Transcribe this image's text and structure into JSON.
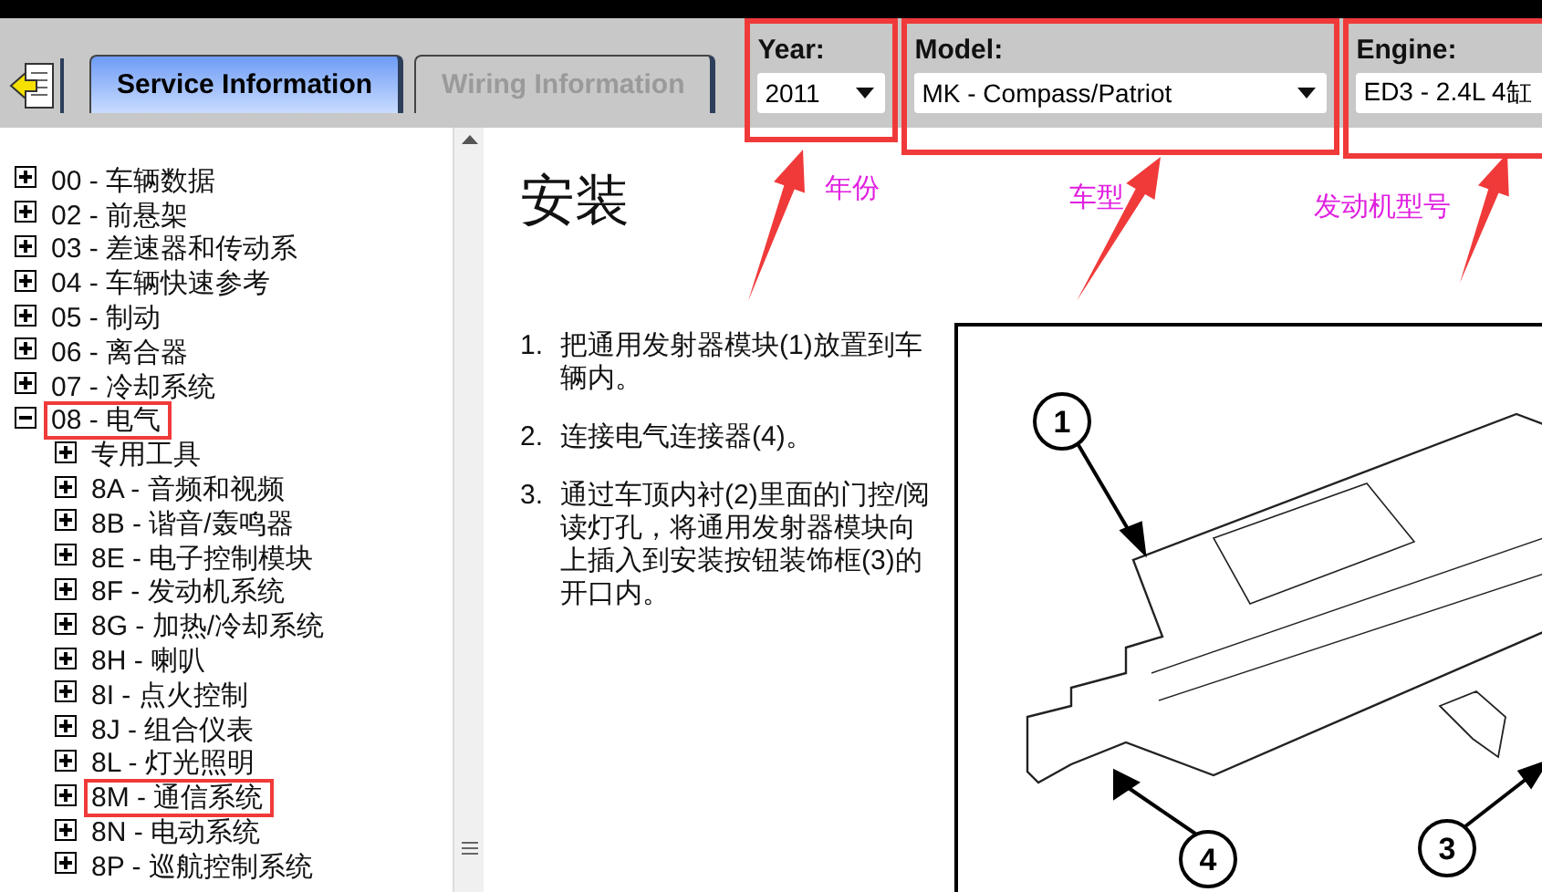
{
  "toolbar": {
    "tabs": [
      {
        "label": "Service Information",
        "selected": true
      },
      {
        "label": "Wiring Information",
        "selected": false
      }
    ],
    "selectors": [
      {
        "label": "Year:",
        "value": "2011",
        "highlighted": true
      },
      {
        "label": "Model:",
        "value": "MK - Compass/Patriot",
        "highlighted": true
      },
      {
        "label": "Engine:",
        "value": "ED3 - 2.4L 4缸",
        "highlighted": true
      }
    ]
  },
  "tree": [
    {
      "label": "00 - 车辆数据",
      "expanded": false,
      "highlighted": false
    },
    {
      "label": "02 - 前悬架",
      "expanded": false,
      "highlighted": false
    },
    {
      "label": "03 - 差速器和传动系",
      "expanded": false,
      "highlighted": false
    },
    {
      "label": "04 - 车辆快速参考",
      "expanded": false,
      "highlighted": false
    },
    {
      "label": "05 - 制动",
      "expanded": false,
      "highlighted": false
    },
    {
      "label": "06 - 离合器",
      "expanded": false,
      "highlighted": false
    },
    {
      "label": "07 - 冷却系统",
      "expanded": false,
      "highlighted": false
    },
    {
      "label": "08 - 电气",
      "expanded": true,
      "highlighted": true,
      "children": [
        {
          "label": "专用工具",
          "expanded": false,
          "highlighted": false
        },
        {
          "label": "8A - 音频和视频",
          "expanded": false,
          "highlighted": false
        },
        {
          "label": "8B - 谐音/轰鸣器",
          "expanded": false,
          "highlighted": false
        },
        {
          "label": "8E - 电子控制模块",
          "expanded": false,
          "highlighted": false
        },
        {
          "label": "8F - 发动机系统",
          "expanded": false,
          "highlighted": false
        },
        {
          "label": "8G - 加热/冷却系统",
          "expanded": false,
          "highlighted": false
        },
        {
          "label": "8H - 喇叭",
          "expanded": false,
          "highlighted": false
        },
        {
          "label": "8I - 点火控制",
          "expanded": false,
          "highlighted": false
        },
        {
          "label": "8J - 组合仪表",
          "expanded": false,
          "highlighted": false
        },
        {
          "label": "8L - 灯光照明",
          "expanded": false,
          "highlighted": false
        },
        {
          "label": "8M - 通信系统",
          "expanded": false,
          "highlighted": true
        },
        {
          "label": "8N - 电动系统",
          "expanded": false,
          "highlighted": false
        },
        {
          "label": "8P - 巡航控制系统",
          "expanded": false,
          "highlighted": false
        }
      ]
    }
  ],
  "content": {
    "title": "安装",
    "steps": [
      {
        "number": "1.",
        "text": "把通用发射器模块(1)放置到车辆内。"
      },
      {
        "number": "2.",
        "text": "连接电气连接器(4)。"
      },
      {
        "number": "3.",
        "text": "通过车顶内衬(2)里面的门控/阅读灯孔，将通用发射器模块向上插入到安装按钮装饰框(3)的开口内。"
      }
    ],
    "figure": {
      "callouts": [
        "1",
        "3",
        "4"
      ]
    }
  },
  "annotations": [
    {
      "label": "年份"
    },
    {
      "label": "车型"
    },
    {
      "label": "发动机型号"
    }
  ]
}
